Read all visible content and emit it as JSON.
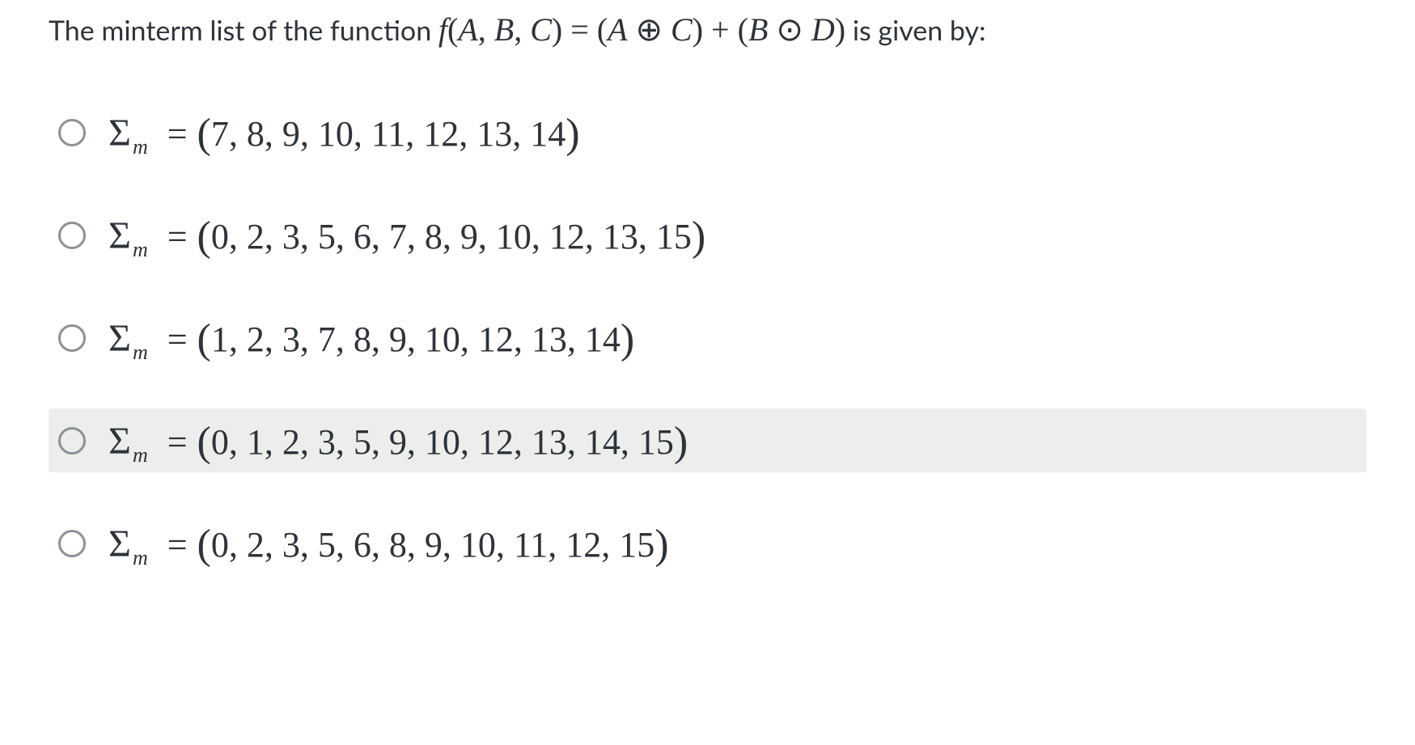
{
  "question": {
    "stem_prefix": "The minterm list of the function ",
    "stem_math": "f(A, B, C) = (A ⊕ C) + (B ⊙ D)",
    "stem_suffix": " is given by:"
  },
  "sigma_label": "Σ",
  "sigma_sub": "m",
  "equals": "=",
  "answers": [
    {
      "list": "7, 8, 9, 10, 11, 12, 13, 14",
      "highlighted": false
    },
    {
      "list": "0, 2, 3, 5, 6, 7, 8, 9, 10, 12, 13, 15",
      "highlighted": false
    },
    {
      "list": "1, 2, 3, 7, 8, 9, 10, 12, 13, 14",
      "highlighted": false
    },
    {
      "list": "0, 1, 2, 3, 5, 9, 10, 12, 13, 14, 15",
      "highlighted": true
    },
    {
      "list": "0, 2, 3, 5, 6, 8, 9, 10, 11, 12, 15",
      "highlighted": false
    }
  ]
}
